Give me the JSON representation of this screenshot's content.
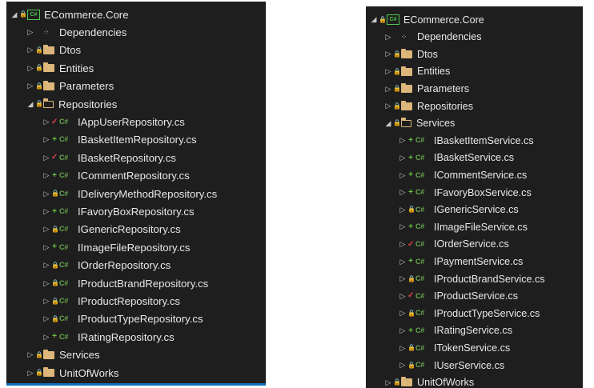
{
  "left_panel": {
    "project": {
      "name": "ECommerce.Core",
      "icon": "csharp-project-icon"
    },
    "dependencies": "Dependencies",
    "folders_top": [
      "Dtos",
      "Entities",
      "Parameters"
    ],
    "open_folder": "Repositories",
    "files": [
      {
        "name": "IAppUserRepository.cs",
        "status": "modified"
      },
      {
        "name": "IBasketItemRepository.cs",
        "status": "added"
      },
      {
        "name": "IBasketRepository.cs",
        "status": "modified"
      },
      {
        "name": "ICommentRepository.cs",
        "status": "added"
      },
      {
        "name": "IDeliveryMethodRepository.cs",
        "status": "locked"
      },
      {
        "name": "IFavoryBoxRepository.cs",
        "status": "added"
      },
      {
        "name": "IGenericRepository.cs",
        "status": "locked"
      },
      {
        "name": "IImageFileRepository.cs",
        "status": "added"
      },
      {
        "name": "IOrderRepository.cs",
        "status": "locked"
      },
      {
        "name": "IProductBrandRepository.cs",
        "status": "locked"
      },
      {
        "name": "IProductRepository.cs",
        "status": "locked"
      },
      {
        "name": "IProductTypeRepository.cs",
        "status": "locked"
      },
      {
        "name": "IRatingRepository.cs",
        "status": "added"
      }
    ],
    "folders_bottom": [
      "Services",
      "UnitOfWorks"
    ]
  },
  "right_panel": {
    "project": {
      "name": "ECommerce.Core",
      "icon": "csharp-project-icon"
    },
    "dependencies": "Dependencies",
    "folders_top": [
      "Dtos",
      "Entities",
      "Parameters",
      "Repositories"
    ],
    "open_folder": "Services",
    "files": [
      {
        "name": "IBasketItemService.cs",
        "status": "added"
      },
      {
        "name": "IBasketService.cs",
        "status": "added"
      },
      {
        "name": "ICommentService.cs",
        "status": "added"
      },
      {
        "name": "IFavoryBoxService.cs",
        "status": "added"
      },
      {
        "name": "IGenericService.cs",
        "status": "locked"
      },
      {
        "name": "IImageFileService.cs",
        "status": "added"
      },
      {
        "name": "IOrderService.cs",
        "status": "modified"
      },
      {
        "name": "IPaymentService.cs",
        "status": "added"
      },
      {
        "name": "IProductBrandService.cs",
        "status": "locked"
      },
      {
        "name": "IProductService.cs",
        "status": "modified"
      },
      {
        "name": "IProductTypeService.cs",
        "status": "locked"
      },
      {
        "name": "IRatingService.cs",
        "status": "added"
      },
      {
        "name": "ITokenService.cs",
        "status": "locked"
      },
      {
        "name": "IUserService.cs",
        "status": "locked"
      }
    ],
    "folders_bottom": [
      "UnitOfWorks"
    ]
  },
  "glyphs": {
    "expanded": "◢",
    "collapsed": "▷",
    "csharp": "C#",
    "lock": "🔒",
    "modified": "✓",
    "added": "+",
    "deps": "⁘"
  },
  "colors": {
    "panel_bg": "#1e1e1e",
    "text": "#dcdcdc",
    "folder": "#dcb67a",
    "csharp": "#68a94e",
    "added": "#6cc644",
    "modified": "#e04343",
    "lock": "#3a96dd",
    "accent": "#0e70c0"
  }
}
